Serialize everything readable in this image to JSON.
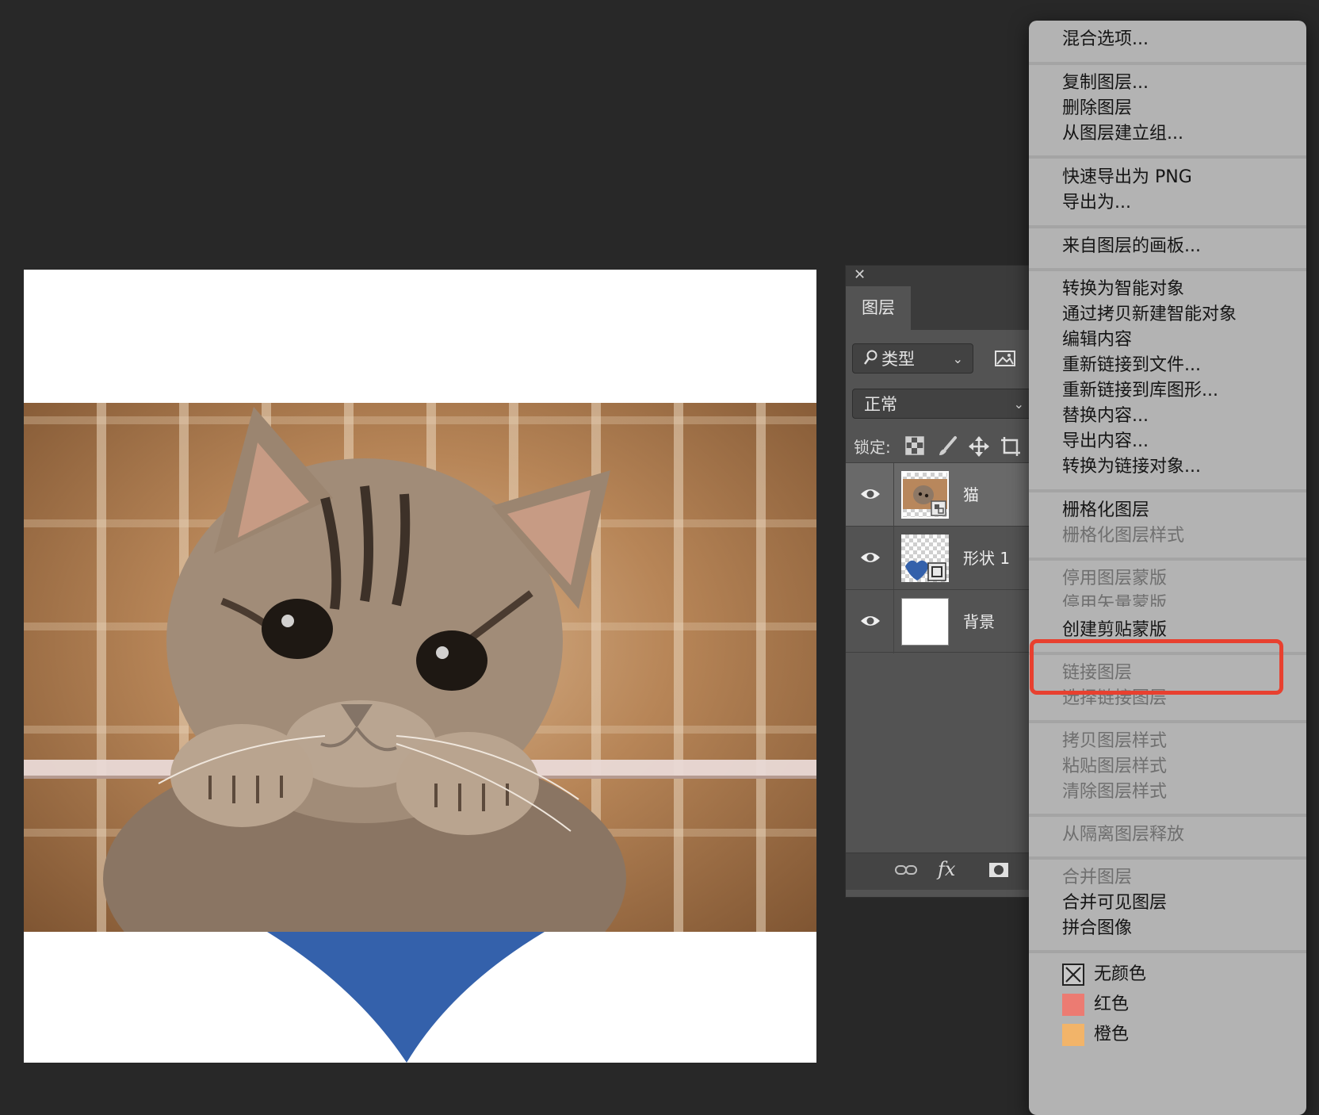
{
  "panel": {
    "tab_label": "图层",
    "close_glyph": "✕",
    "filter_label": "类型",
    "blend_mode": "正常",
    "lock_label": "锁定:",
    "layers": [
      {
        "name": "猫",
        "visible": true,
        "selected": true
      },
      {
        "name": "形状 1",
        "visible": true,
        "selected": false
      },
      {
        "name": "背景",
        "visible": true,
        "selected": false
      }
    ],
    "bottom_fx": "fx"
  },
  "menu": {
    "items": [
      {
        "label": "混合选项...",
        "enabled": true
      },
      {
        "label": "复制图层...",
        "enabled": true
      },
      {
        "label": "删除图层",
        "enabled": true
      },
      {
        "label": "从图层建立组...",
        "enabled": true
      },
      {
        "label": "快速导出为 PNG",
        "enabled": true
      },
      {
        "label": "导出为...",
        "enabled": true
      },
      {
        "label": "来自图层的画板...",
        "enabled": true
      },
      {
        "label": "转换为智能对象",
        "enabled": true
      },
      {
        "label": "通过拷贝新建智能对象",
        "enabled": true
      },
      {
        "label": "编辑内容",
        "enabled": true
      },
      {
        "label": "重新链接到文件...",
        "enabled": true
      },
      {
        "label": "重新链接到库图形...",
        "enabled": true
      },
      {
        "label": "替换内容...",
        "enabled": true
      },
      {
        "label": "导出内容...",
        "enabled": true
      },
      {
        "label": "转换为链接对象...",
        "enabled": true
      },
      {
        "label": "栅格化图层",
        "enabled": true
      },
      {
        "label": "栅格化图层样式",
        "enabled": false
      },
      {
        "label": "停用图层蒙版",
        "enabled": false
      },
      {
        "label": "停用矢量蒙版",
        "enabled": false
      },
      {
        "label": "创建剪贴蒙版",
        "enabled": true,
        "highlighted": true
      },
      {
        "label": "链接图层",
        "enabled": false
      },
      {
        "label": "选择链接图层",
        "enabled": false
      },
      {
        "label": "拷贝图层样式",
        "enabled": false
      },
      {
        "label": "粘贴图层样式",
        "enabled": false
      },
      {
        "label": "清除图层样式",
        "enabled": false
      },
      {
        "label": "从隔离图层释放",
        "enabled": false
      },
      {
        "label": "合并图层",
        "enabled": false
      },
      {
        "label": "合并可见图层",
        "enabled": true
      },
      {
        "label": "拼合图像",
        "enabled": true
      }
    ],
    "colors": [
      {
        "label": "无颜色",
        "swatch": "none"
      },
      {
        "label": "红色",
        "swatch": "#ec7b72"
      },
      {
        "label": "橙色",
        "swatch": "#f2b469"
      }
    ]
  },
  "colors": {
    "highlight_border": "#e8402f",
    "heart_blue": "#3461ab"
  }
}
